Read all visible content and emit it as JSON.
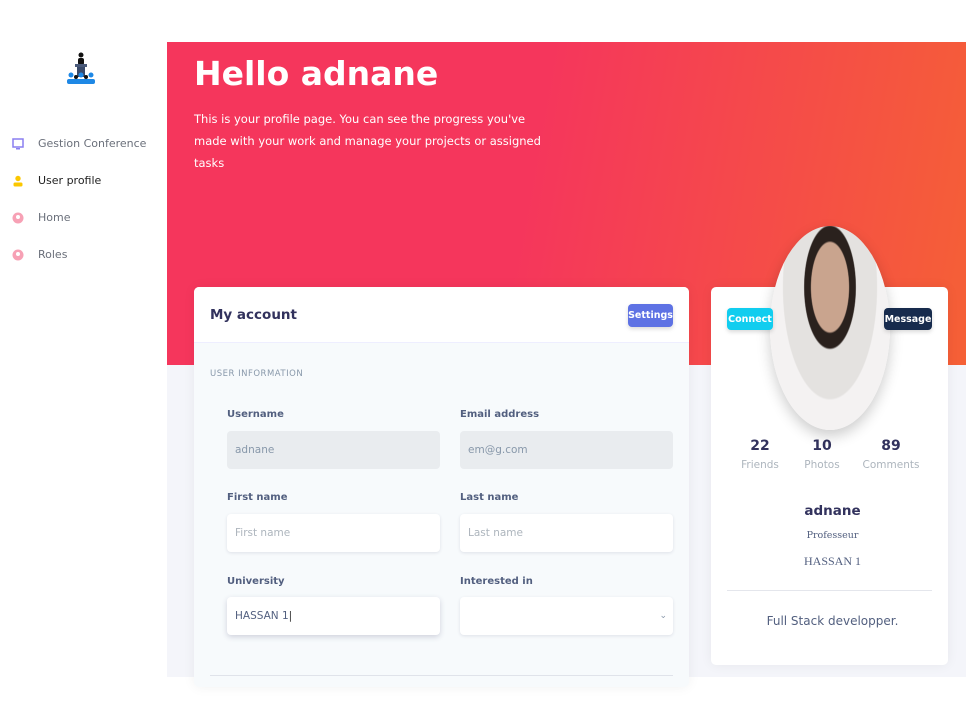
{
  "sidebar": {
    "items": [
      {
        "label": "Gestion Conference",
        "icon": "monitor-icon"
      },
      {
        "label": "User profile",
        "icon": "user-icon"
      },
      {
        "label": "Home",
        "icon": "user-circle-icon"
      },
      {
        "label": "Roles",
        "icon": "user-circle-icon"
      }
    ]
  },
  "header": {
    "title": "Hello adnane",
    "description": "This is your profile page. You can see the progress you've made with your work and manage your projects or assigned tasks"
  },
  "account": {
    "title": "My account",
    "settings_label": "Settings",
    "section": "USER INFORMATION",
    "fields": {
      "username": {
        "label": "Username",
        "value": "adnane"
      },
      "email": {
        "label": "Email address",
        "value": "em@g.com"
      },
      "first_name": {
        "label": "First name",
        "placeholder": "First name"
      },
      "last_name": {
        "label": "Last name",
        "placeholder": "Last name"
      },
      "university": {
        "label": "University",
        "value": "HASSAN 1"
      },
      "interested": {
        "label": "Interested in",
        "value": ""
      }
    }
  },
  "profile": {
    "connect_label": "Connect",
    "message_label": "Message",
    "stats": [
      {
        "value": "22",
        "label": "Friends"
      },
      {
        "value": "10",
        "label": "Photos"
      },
      {
        "value": "89",
        "label": "Comments"
      }
    ],
    "name": "adnane",
    "role": "Professeur",
    "university": "HASSAN 1",
    "bio": "Full Stack developper."
  },
  "colors": {
    "primary": "#5e72e4",
    "info": "#11cdef",
    "dark": "#172b4d",
    "header_start": "#f5365c",
    "header_end": "#f56036"
  }
}
